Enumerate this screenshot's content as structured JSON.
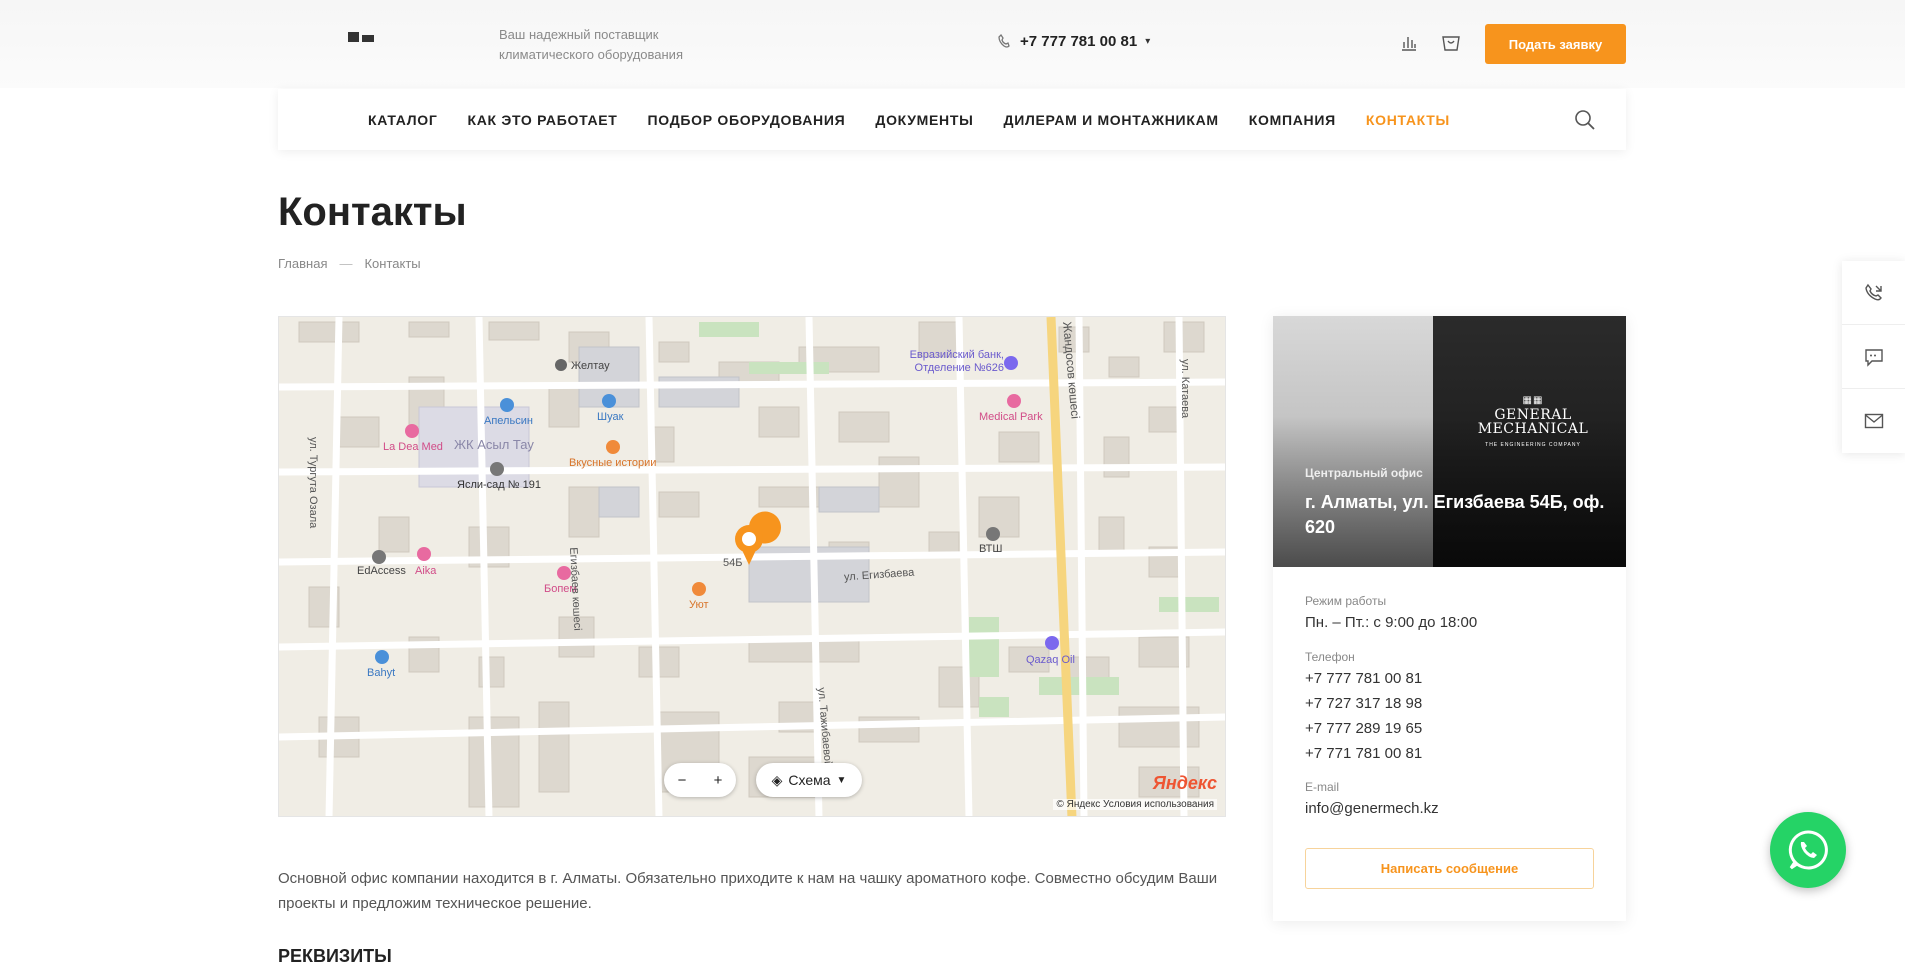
{
  "header": {
    "tagline": "Ваш надежный поставщик климатического оборудования",
    "phone": "+7 777 781 00 81",
    "cta_label": "Подать заявку",
    "accent_color": "#f7941d"
  },
  "nav": {
    "items": [
      {
        "label": "КАТАЛОГ"
      },
      {
        "label": "КАК ЭТО РАБОТАЕТ"
      },
      {
        "label": "ПОДБОР ОБОРУДОВАНИЯ"
      },
      {
        "label": "ДОКУМЕНТЫ"
      },
      {
        "label": "ДИЛЕРАМ И МОНТАЖНИКАМ"
      },
      {
        "label": "КОМПАНИЯ"
      },
      {
        "label": "КОНТАКТЫ"
      }
    ],
    "active_index": 6
  },
  "page": {
    "title": "Контакты",
    "breadcrumbs": [
      "Главная",
      "Контакты"
    ]
  },
  "map": {
    "labels": {
      "zhk": "ЖК Асыл Тау",
      "yasli": "Ясли-сад № 191",
      "apelsin": "Апельсин",
      "shuak": "Шуак",
      "ladea": "La Dea Med",
      "vkusnye": "Вкусные истории",
      "zheltau": "Желтау",
      "evraz": "Евразийский банк, Отделение №626",
      "medpark": "Medical Park",
      "vtsh": "ВТШ",
      "edaccess": "EdAccess",
      "aika": "Aika",
      "bopem": "Бопем",
      "uyut": "Уют",
      "bahyt": "Bahyt",
      "qazaq": "Qazaq Oil",
      "street_egizbaeva": "ул. Егизбаева",
      "street_egizbaev_k": "Егизбаев көшесі",
      "street_zhandosov": "Жандосов көшесі",
      "street_katayeva": "ул. Катаева",
      "street_turguta": "ул. Тургута Озала",
      "street_tazhibaeva": "ул. Тажибаевой",
      "bldg_54b": "54Б"
    },
    "layer_label": "Схема",
    "provider": "Яндекс",
    "copyright": "© Яндекс Условия использования"
  },
  "office": {
    "label": "Центральный офис",
    "address": "г. Алматы, ул. Егизбаева 54Б, оф. 620",
    "brand_line1": "GENERAL",
    "brand_line2": "MECHANICAL",
    "brand_sub": "THE ENGINEERING COMPANY",
    "hours_label": "Режим работы",
    "hours_value": "Пн. – Пт.: с 9:00 до 18:00",
    "phone_label": "Телефон",
    "phones": [
      "+7 777 781 00 81",
      "+7 727 317 18 98",
      "+7 777 289 19 65",
      "+7 771 781 00 81"
    ],
    "email_label": "E-mail",
    "email": "info@genermech.kz",
    "message_button": "Написать сообщение"
  },
  "about": {
    "text": "Основной офис компании находится в г. Алматы. Обязательно приходите к нам на чашку ароматного кофе. Совместно обсудим Ваши проекты и предложим техническое решение."
  },
  "requisites": {
    "title": "РЕКВИЗИТЫ"
  }
}
